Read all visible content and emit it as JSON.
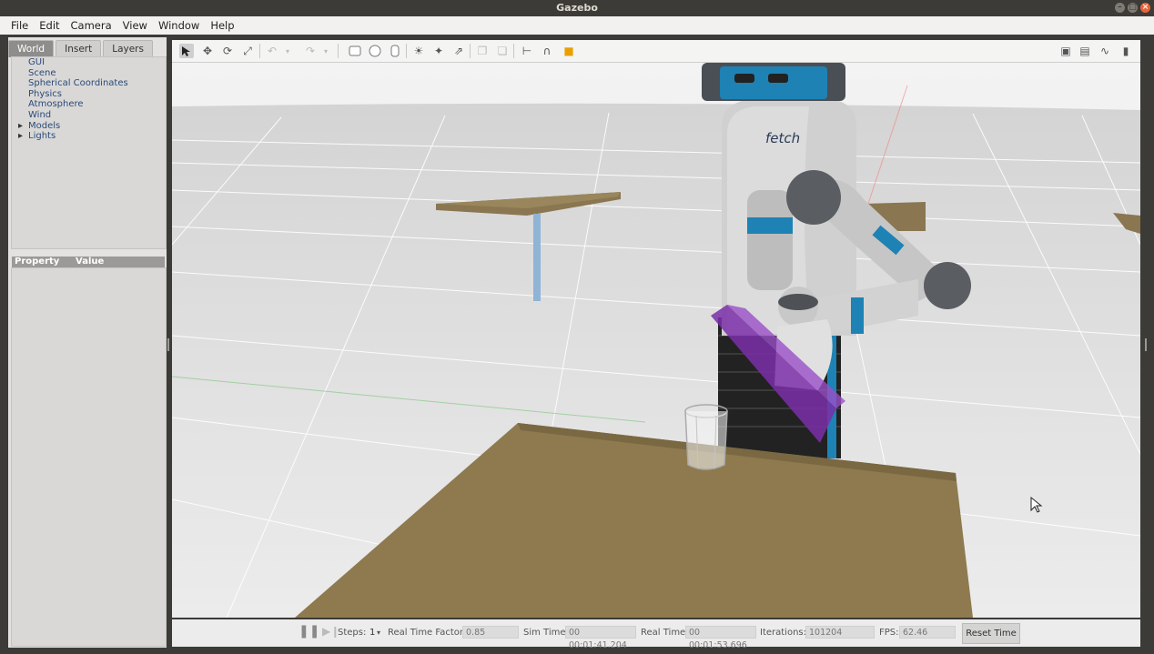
{
  "window": {
    "title": "Gazebo"
  },
  "menu": [
    "File",
    "Edit",
    "Camera",
    "View",
    "Window",
    "Help"
  ],
  "left_panel": {
    "tabs": [
      "World",
      "Insert",
      "Layers"
    ],
    "active_tab": "World",
    "tree_items": [
      "GUI",
      "Scene",
      "Spherical Coordinates",
      "Physics",
      "Atmosphere",
      "Wind",
      "Models",
      "Lights"
    ],
    "property_headers": {
      "property": "Property",
      "value": "Value"
    }
  },
  "toolbar": {
    "left_icons": [
      "select-arrow-icon",
      "translate-icon",
      "rotate-icon",
      "scale-icon",
      "undo-icon",
      "undo-dropdown-icon",
      "redo-icon",
      "redo-dropdown-icon",
      "box-shape-icon",
      "sphere-shape-icon",
      "cylinder-shape-icon",
      "point-light-icon",
      "spot-light-icon",
      "directional-light-icon",
      "copy-icon",
      "paste-icon",
      "align-icon",
      "snap-icon",
      "change-view-icon"
    ],
    "right_icons": [
      "screenshot-icon",
      "log-icon",
      "plot-icon",
      "video-record-icon"
    ]
  },
  "scene": {
    "logo_text": "fetch",
    "colors": {
      "table": "#8e7a4e",
      "robot_accent": "#1e82b4",
      "gripped_object": "#7a2fa8"
    }
  },
  "bottom_bar": {
    "steps_label": "Steps:",
    "steps_value": "1",
    "real_time_factor_label": "Real Time Factor:",
    "real_time_factor_value": "0.85",
    "sim_time_label": "Sim Time:",
    "sim_time_value": "00 00:01:41.204",
    "real_time_label": "Real Time:",
    "real_time_value": "00 00:01:53.696",
    "iterations_label": "Iterations:",
    "iterations_value": "101204",
    "fps_label": "FPS:",
    "fps_value": "62.46",
    "reset_button_label": "Reset Time"
  }
}
